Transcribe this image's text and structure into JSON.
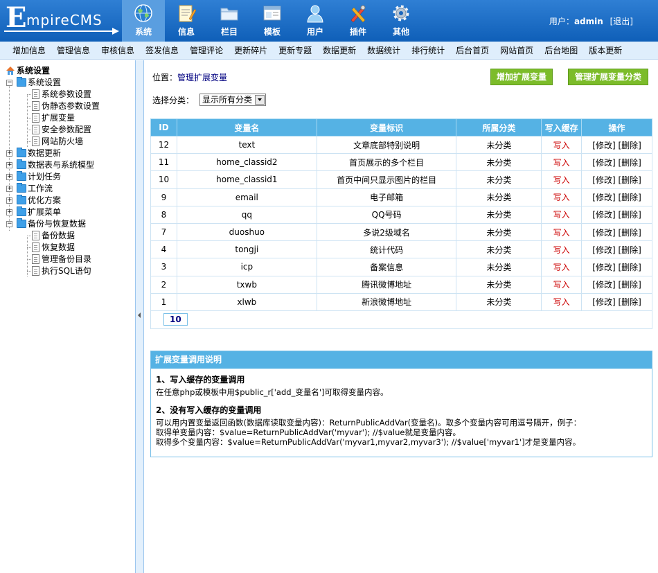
{
  "header": {
    "logo_first": "E",
    "logo_rest": "mpireCMS",
    "nav": [
      {
        "label": "系统",
        "icon": "globe-icon",
        "active": true
      },
      {
        "label": "信息",
        "icon": "notepad-icon",
        "active": false
      },
      {
        "label": "栏目",
        "icon": "folder-icon",
        "active": false
      },
      {
        "label": "模板",
        "icon": "window-icon",
        "active": false
      },
      {
        "label": "用户",
        "icon": "user-icon",
        "active": false
      },
      {
        "label": "插件",
        "icon": "tools-icon",
        "active": false
      },
      {
        "label": "其他",
        "icon": "gear-icon",
        "active": false
      }
    ],
    "user_label": "用户：",
    "user_name": "admin",
    "logout": "[退出]"
  },
  "submenu": [
    "增加信息",
    "管理信息",
    "审核信息",
    "签发信息",
    "管理评论",
    "更新碎片",
    "更新专题",
    "数据更新",
    "数据统计",
    "排行统计",
    "后台首页",
    "网站首页",
    "后台地图",
    "版本更新"
  ],
  "sidebar": {
    "root": "系统设置",
    "nodes": [
      {
        "label": "系统设置",
        "expanded": true,
        "children": [
          "系统参数设置",
          "伪静态参数设置",
          "扩展变量",
          "安全参数配置",
          "网站防火墙"
        ]
      },
      {
        "label": "数据更新",
        "expanded": false,
        "children": []
      },
      {
        "label": "数据表与系统模型",
        "expanded": false,
        "children": []
      },
      {
        "label": "计划任务",
        "expanded": false,
        "children": []
      },
      {
        "label": "工作流",
        "expanded": false,
        "children": []
      },
      {
        "label": "优化方案",
        "expanded": false,
        "children": []
      },
      {
        "label": "扩展菜单",
        "expanded": false,
        "children": []
      },
      {
        "label": "备份与恢复数据",
        "expanded": true,
        "children": [
          "备份数据",
          "恢复数据",
          "管理备份目录",
          "执行SQL语句"
        ]
      }
    ]
  },
  "main": {
    "location_label": "位置：",
    "location_link": "管理扩展变量",
    "add_button": "增加扩展变量",
    "manage_category_button": "管理扩展变量分类",
    "filter_label": "选择分类：",
    "filter_value": "显示所有分类",
    "table": {
      "headers": [
        "ID",
        "变量名",
        "变量标识",
        "所属分类",
        "写入缓存",
        "操作"
      ],
      "rows": [
        {
          "id": "12",
          "name": "text",
          "mark": "文章底部特别说明",
          "cat": "未分类",
          "cache": "写入",
          "edit": "[修改]",
          "del": "[删除]"
        },
        {
          "id": "11",
          "name": "home_classid2",
          "mark": "首页展示的多个栏目",
          "cat": "未分类",
          "cache": "写入",
          "edit": "[修改]",
          "del": "[删除]"
        },
        {
          "id": "10",
          "name": "home_classid1",
          "mark": "首页中间只显示图片的栏目",
          "cat": "未分类",
          "cache": "写入",
          "edit": "[修改]",
          "del": "[删除]"
        },
        {
          "id": "9",
          "name": "email",
          "mark": "电子邮箱",
          "cat": "未分类",
          "cache": "写入",
          "edit": "[修改]",
          "del": "[删除]"
        },
        {
          "id": "8",
          "name": "qq",
          "mark": "QQ号码",
          "cat": "未分类",
          "cache": "写入",
          "edit": "[修改]",
          "del": "[删除]"
        },
        {
          "id": "7",
          "name": "duoshuo",
          "mark": "多说2级域名",
          "cat": "未分类",
          "cache": "写入",
          "edit": "[修改]",
          "del": "[删除]"
        },
        {
          "id": "4",
          "name": "tongji",
          "mark": "统计代码",
          "cat": "未分类",
          "cache": "写入",
          "edit": "[修改]",
          "del": "[删除]"
        },
        {
          "id": "3",
          "name": "icp",
          "mark": "备案信息",
          "cat": "未分类",
          "cache": "写入",
          "edit": "[修改]",
          "del": "[删除]"
        },
        {
          "id": "2",
          "name": "txwb",
          "mark": "腾讯微博地址",
          "cat": "未分类",
          "cache": "写入",
          "edit": "[修改]",
          "del": "[删除]"
        },
        {
          "id": "1",
          "name": "xlwb",
          "mark": "新浪微博地址",
          "cat": "未分类",
          "cache": "写入",
          "edit": "[修改]",
          "del": "[删除]"
        }
      ],
      "page_count": "10"
    },
    "help": {
      "title": "扩展变量调用说明",
      "section1_title": "1、写入缓存的变量调用",
      "section1_text": "在任意php或模板中用$public_r['add_变量名']可取得变量内容。",
      "section2_title": "2、没有写入缓存的变量调用",
      "section2_line1": "可以用内置变量返回函数(数据库读取变量内容)：ReturnPublicAddVar(变量名)。取多个变量内容可用逗号隔开，例子：",
      "section2_line2": "取得单变量内容：$value=ReturnPublicAddVar('myvar'); //$value就是变量内容。",
      "section2_line3": "取得多个变量内容：$value=ReturnPublicAddVar('myvar1,myvar2,myvar3'); //$value['myvar1']才是变量内容。"
    }
  },
  "colors": {
    "header_blue": "#1e6fc8",
    "table_header": "#55b2e4",
    "green_button": "#7cbc2a",
    "write_red": "#cc0000"
  }
}
